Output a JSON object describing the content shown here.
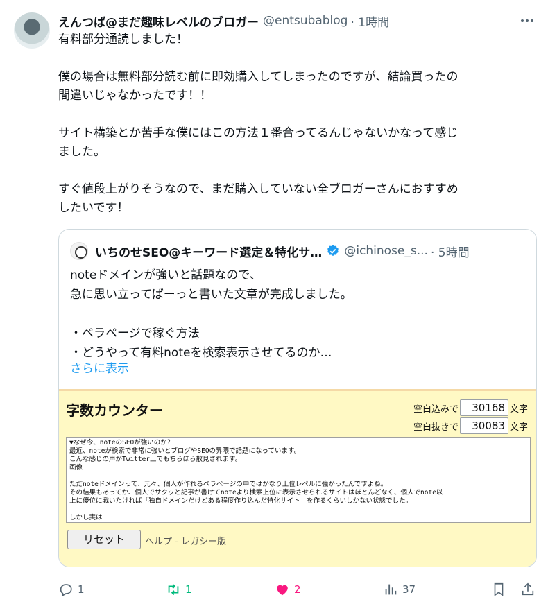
{
  "tweet": {
    "author_name": "えんつば@まだ趣味レベルのブロガー",
    "handle": "@entsubablog",
    "time": "· 1時間",
    "text": "有料部分通読しました！\n\n僕の場合は無料部分読む前に即効購入してしまったのですが、結論買ったの\n間違いじゃなかったです！！\n\nサイト構築とか苦手な僕にはこの方法１番合ってるんじゃないかなって感じ\nました。\n\nすぐ値段上がりそうなので、まだ購入していない全ブロガーさんにおすすめ\nしたいです！"
  },
  "quote": {
    "author_name": "いちのせSEO@キーワード選定＆特化サ…",
    "handle": "@ichinose_s...",
    "time": "· 5時間",
    "text": "noteドメインが強いと話題なので、\n急に思い立ってばーっと書いた文章が完成しました。\n\n・ペラページで稼ぐ方法\n・どうやって有料noteを検索表示させてるのか…",
    "show_more": "さらに表示"
  },
  "counter": {
    "title": "字数カウンター",
    "with_spaces_label": "空白込みで",
    "with_spaces_value": "30168",
    "without_spaces_label": "空白抜きで",
    "without_spaces_value": "30083",
    "unit": "文字",
    "textarea": "▼なぜ今、noteのSEOが強いのか？\n最近、noteが検索で非常に強いとブログやSEOの界隈で話題になっています。\nこんな感じの声がTwitter上でもちらほら散見されます。\n画像\n\nただnoteドメインって、元々、個人が作れるペラページの中ではかなり上位レベルに強かったんですよね。\nその結果もあってか、個人でサクッと記事が書けてnoteより検索上位に表示させられるサイトはほとんどなく、個人でnote以\n上に優位に戦いたければ「独自ドメインだけどある程度作り込んだ特化サイト」を作るくらいしかない状態でした。\n\nしかし実は",
    "reset_label": "リセット",
    "links": "ヘルプ - レガシー版"
  },
  "actions": {
    "replies": "1",
    "retweets": "1",
    "likes": "2",
    "views": "37"
  },
  "colors": {
    "like": "#f91880",
    "retweet": "#00ba7c",
    "link": "#1d9bf0",
    "counter_bg": "#fff9c4"
  }
}
